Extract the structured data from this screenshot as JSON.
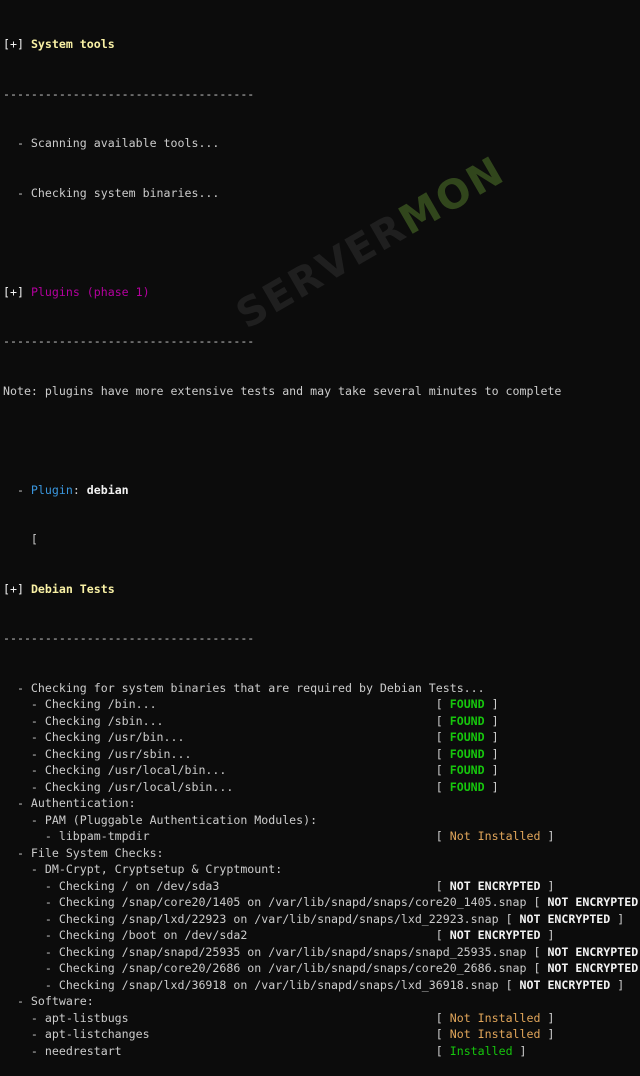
{
  "sections": {
    "system_tools": {
      "marker": "[+]",
      "title": "System tools",
      "separator": "------------------------------------",
      "items": [
        "  - Scanning available tools...",
        "  - Checking system binaries..."
      ]
    },
    "plugins": {
      "marker": "[+]",
      "title": "Plugins (phase 1)",
      "separator": "------------------------------------",
      "note": "Note: plugins have more extensive tests and may take several minutes to complete",
      "plugin_label": "Plugin",
      "plugin_name": "debian",
      "bracket": "    ["
    },
    "debian": {
      "marker": "[+]",
      "title": "Debian Tests",
      "separator": "------------------------------------"
    }
  },
  "lines": [
    {
      "text": "  - Checking for system binaries that are required by Debian Tests...",
      "status": "",
      "type": ""
    },
    {
      "text": "    - Checking /bin...                                        ",
      "status": "FOUND",
      "type": "found"
    },
    {
      "text": "    - Checking /sbin...                                       ",
      "status": "FOUND",
      "type": "found"
    },
    {
      "text": "    - Checking /usr/bin...                                    ",
      "status": "FOUND",
      "type": "found"
    },
    {
      "text": "    - Checking /usr/sbin...                                   ",
      "status": "FOUND",
      "type": "found"
    },
    {
      "text": "    - Checking /usr/local/bin...                              ",
      "status": "FOUND",
      "type": "found"
    },
    {
      "text": "    - Checking /usr/local/sbin...                             ",
      "status": "FOUND",
      "type": "found"
    },
    {
      "text": "  - Authentication:",
      "status": "",
      "type": ""
    },
    {
      "text": "    - PAM (Pluggable Authentication Modules):",
      "status": "",
      "type": ""
    },
    {
      "text": "      - libpam-tmpdir                                         ",
      "status": "Not Installed",
      "type": "notinst"
    },
    {
      "text": "  - File System Checks:",
      "status": "",
      "type": ""
    },
    {
      "text": "    - DM-Crypt, Cryptsetup & Cryptmount:",
      "status": "",
      "type": ""
    },
    {
      "text": "      - Checking / on /dev/sda3                               ",
      "status": "NOT ENCRYPTED",
      "type": "notenc"
    },
    {
      "text": "      - Checking /snap/core20/1405 on /var/lib/snapd/snaps/core20_1405.snap ",
      "status": "NOT ENCRYPTED",
      "type": "notenc"
    },
    {
      "text": "      - Checking /snap/lxd/22923 on /var/lib/snapd/snaps/lxd_22923.snap ",
      "status": "NOT ENCRYPTED",
      "type": "notenc"
    },
    {
      "text": "      - Checking /boot on /dev/sda2                           ",
      "status": "NOT ENCRYPTED",
      "type": "notenc"
    },
    {
      "text": "      - Checking /snap/snapd/25935 on /var/lib/snapd/snaps/snapd_25935.snap ",
      "status": "NOT ENCRYPTED",
      "type": "notenc"
    },
    {
      "text": "      - Checking /snap/core20/2686 on /var/lib/snapd/snaps/core20_2686.snap ",
      "status": "NOT ENCRYPTED",
      "type": "notenc"
    },
    {
      "text": "      - Checking /snap/lxd/36918 on /var/lib/snapd/snaps/lxd_36918.snap ",
      "status": "NOT ENCRYPTED",
      "type": "notenc"
    },
    {
      "text": "  - Software:",
      "status": "",
      "type": ""
    },
    {
      "text": "    - apt-listbugs                                            ",
      "status": "Not Installed",
      "type": "notinst"
    },
    {
      "text": "    - apt-listchanges                                         ",
      "status": "Not Installed",
      "type": "notinst"
    },
    {
      "text": "    - needrestart                                             ",
      "status": "Installed",
      "type": "installed"
    }
  ],
  "colors": {
    "background": "#0c0c0c",
    "text": "#cccccc",
    "heading_yellow": "#f9f1a5",
    "heading_magenta": "#b4009e",
    "plugin_cyan": "#3a96dd",
    "found_green": "#16c60c",
    "not_installed_orange": "#e0a55a"
  }
}
